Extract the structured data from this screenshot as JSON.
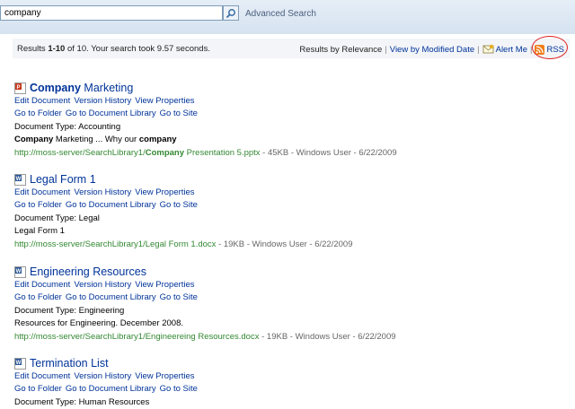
{
  "search": {
    "query": "company",
    "advanced_label": "Advanced Search"
  },
  "results_bar": {
    "summary_pre": "Results ",
    "range": "1-10",
    "summary_mid": " of 10. Your search took 9.57 seconds.",
    "relevance_label": "Results by Relevance",
    "sep": "|",
    "modified_label": "View by Modified Date",
    "alert_label": "Alert Me",
    "rss_label": "RSS"
  },
  "actions": {
    "edit": "Edit Document",
    "history": "Version History",
    "props": "View Properties",
    "folder": "Go to Folder",
    "library": "Go to Document Library",
    "site": "Go to Site"
  },
  "results": [
    {
      "title_bold": "Company",
      "title_rest": " Marketing",
      "doc_type": "Document Type: Accounting",
      "snip_bold1": "Company",
      "snip_mid": " Marketing ... Why our ",
      "snip_bold2": "company",
      "url_pre": "http://moss-server/SearchLibrary1/",
      "url_bold": "Company",
      "url_post": " Presentation 5.pptx",
      "meta": " - 45KB - Windows User - 6/22/2009",
      "icon_color": "#c8371a"
    },
    {
      "title": "Legal Form 1",
      "doc_type": "Document Type: Legal",
      "snippet": "Legal Form 1",
      "url": "http://moss-server/SearchLibrary1/Legal Form 1.docx",
      "meta": " - 19KB - Windows User - 6/22/2009",
      "icon_color": "#2b5797"
    },
    {
      "title": "Engineering Resources",
      "doc_type": "Document Type: Engineering",
      "snippet": "Resources for Engineering. December 2008.",
      "url": "http://moss-server/SearchLibrary1/Engineereing Resources.docx",
      "meta": " - 19KB - Windows User - 6/22/2009",
      "icon_color": "#2b5797"
    },
    {
      "title": "Termination List",
      "doc_type": "Document Type: Human Resources",
      "icon_color": "#2b5797"
    }
  ]
}
